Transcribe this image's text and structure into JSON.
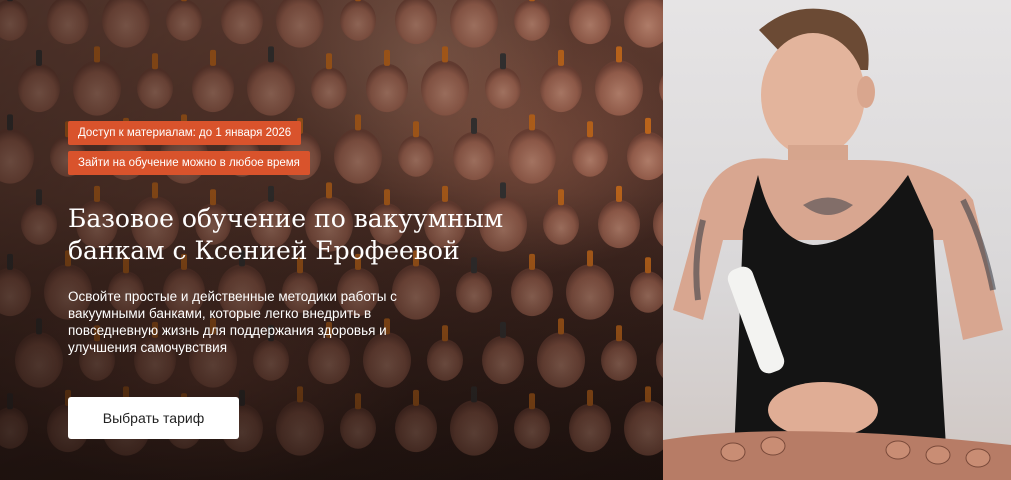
{
  "badges": {
    "access": "Доступ к материалам: до 1 января 2026",
    "enroll": "Зайти на обучение можно в любое время"
  },
  "hero": {
    "title": "Базовое обучение по вакуумным банкам с Ксенией Ерофеевой",
    "subtitle": "Освойте простые и действенные методики работы с вакуумными банками, которые легко внедрить в повседневную жизнь для поддержания здоровья и улучшения самочувствия",
    "cta_label": "Выбрать тариф"
  },
  "colors": {
    "badge": "#d9532c",
    "cta_bg": "#ffffff",
    "text": "#ffffff"
  }
}
